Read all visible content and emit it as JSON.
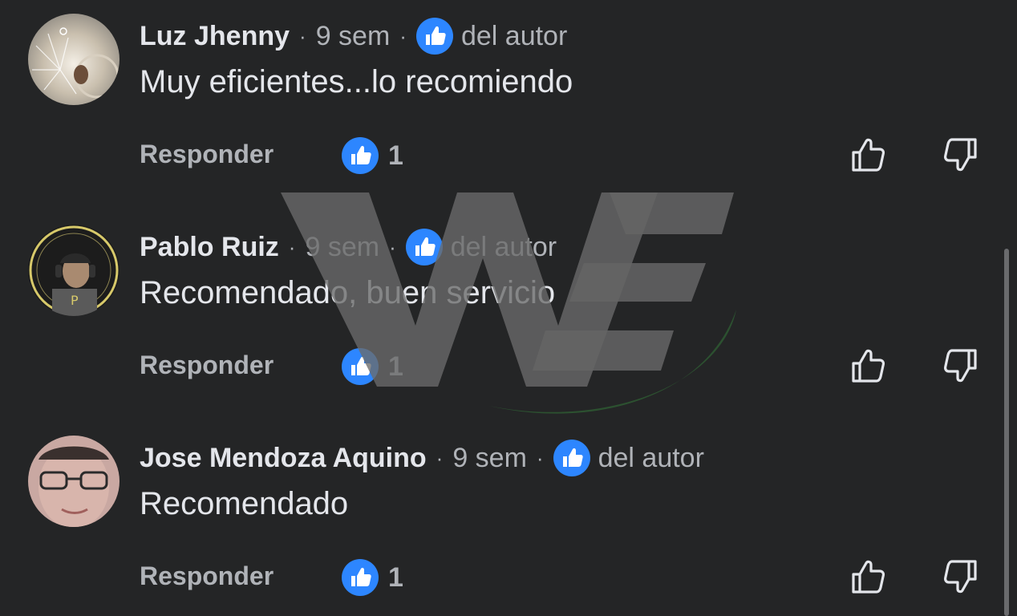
{
  "comments": [
    {
      "author": "Luz Jhenny",
      "time": "9 sem",
      "author_like_label": "del autor",
      "text": "Muy eficientes...lo recomiendo",
      "reply_label": "Responder",
      "reaction_count": "1",
      "avatar_icon": "avatar-sparkler-photo"
    },
    {
      "author": "Pablo Ruiz",
      "time": "9 sem",
      "author_like_label": "del autor",
      "text": "Recomendado, buen servicio",
      "reply_label": "Responder",
      "reaction_count": "1",
      "avatar_icon": "avatar-person-headset-photo"
    },
    {
      "author": "Jose Mendoza Aquino",
      "time": "9 sem",
      "author_like_label": "del autor",
      "text": "Recomendado",
      "reply_label": "Responder",
      "reaction_count": "1",
      "avatar_icon": "avatar-person-glasses-photo"
    }
  ],
  "separator": "·",
  "icons": {
    "like_badge": "thumbs-up-icon",
    "upvote": "thumb-up-outline-icon",
    "downvote": "thumb-down-outline-icon",
    "watermark": "we-logo-watermark"
  },
  "colors": {
    "background": "#242526",
    "primary_text": "#e4e6eb",
    "secondary_text": "#b0b3b8",
    "like_blue": "#2d86ff",
    "watermark_gray": "#6b6b6b",
    "watermark_green": "#2f5a33"
  }
}
